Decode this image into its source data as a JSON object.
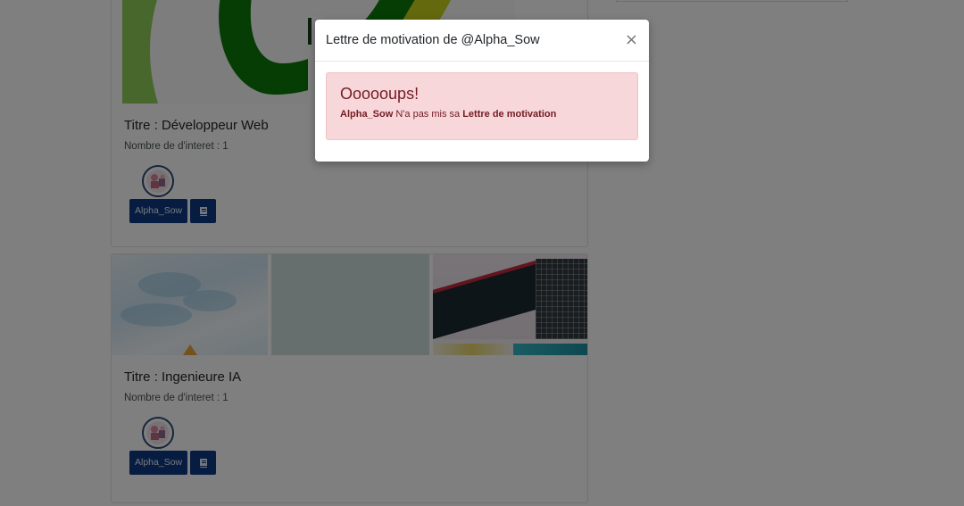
{
  "cards": [
    {
      "title": "Titre : Développeur Web",
      "interest": "Nombre de d'interet : 1",
      "user_button": "Alpha_Sow"
    },
    {
      "title": "Titre : Ingenieure IA",
      "interest": "Nombre de d'interet : 1",
      "user_button": "Alpha_Sow"
    }
  ],
  "modal": {
    "title": "Lettre de motivation de @Alpha_Sow",
    "close": "×",
    "alert_heading": "Oooooups!",
    "alert_user": "Alpha_Sow",
    "alert_middle": " N'a pas mis sa ",
    "alert_doc": "Lettre de motivation"
  },
  "icons": {
    "close": "close-icon",
    "book": "book-icon",
    "avatar": "avatar-icon"
  },
  "colors": {
    "primary_button": "#0d3a82",
    "alert_background": "#f8d7da",
    "alert_text": "#721c24"
  }
}
